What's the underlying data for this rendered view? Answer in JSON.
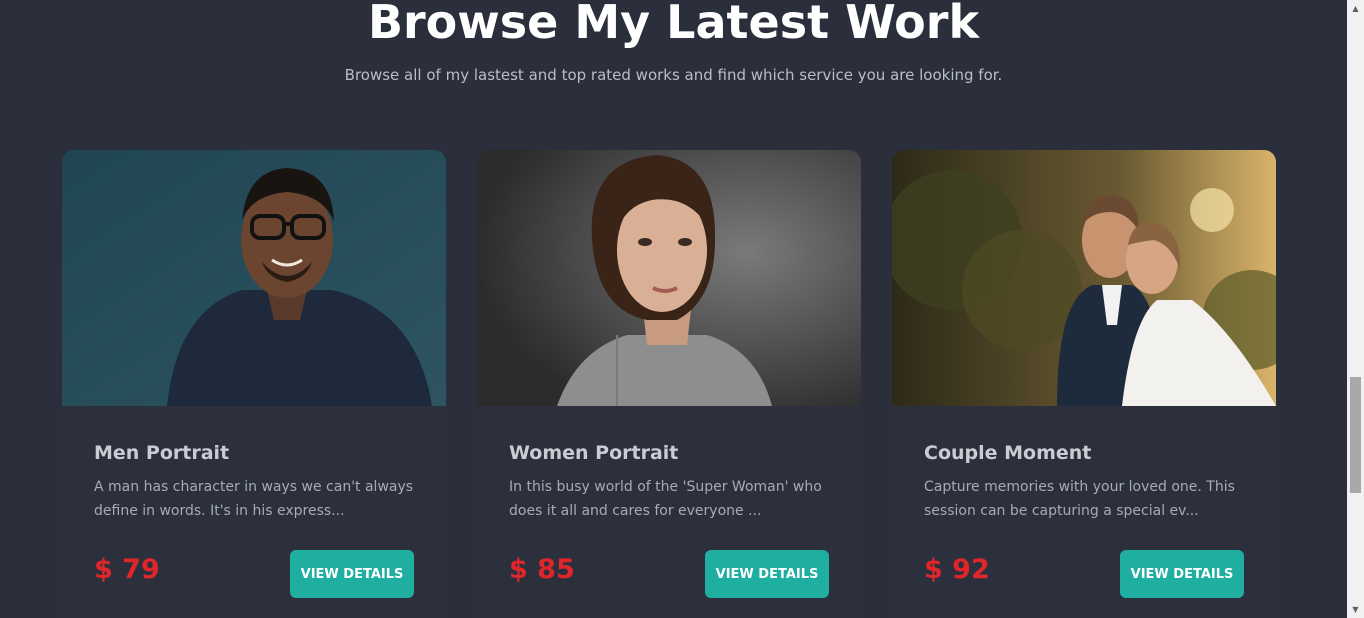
{
  "section": {
    "title": "Browse My Latest Work",
    "subtitle": "Browse all of my lastest and top rated works and find which service you are looking for."
  },
  "cards": [
    {
      "title": "Men Portrait",
      "description": "A man has character in ways we can't always define in words. It's in his express...",
      "price": "$ 79",
      "button_label": "VIEW DETAILS",
      "image_alt": "man-portrait-photo"
    },
    {
      "title": "Women Portrait",
      "description": "In this busy world of the 'Super Woman' who does it all and cares for everyone ...",
      "price": "$ 85",
      "button_label": "VIEW DETAILS",
      "image_alt": "woman-portrait-photo"
    },
    {
      "title": "Couple Moment",
      "description": "Capture memories with your loved one. This session can be capturing a special ev...",
      "price": "$ 92",
      "button_label": "VIEW DETAILS",
      "image_alt": "couple-photo"
    }
  ],
  "colors": {
    "background": "#2a2f3b",
    "price": "#e0262b",
    "button": "#1fafa0"
  },
  "scrollbar": {
    "up_icon": "arrow-up-icon",
    "down_icon": "arrow-down-icon"
  }
}
